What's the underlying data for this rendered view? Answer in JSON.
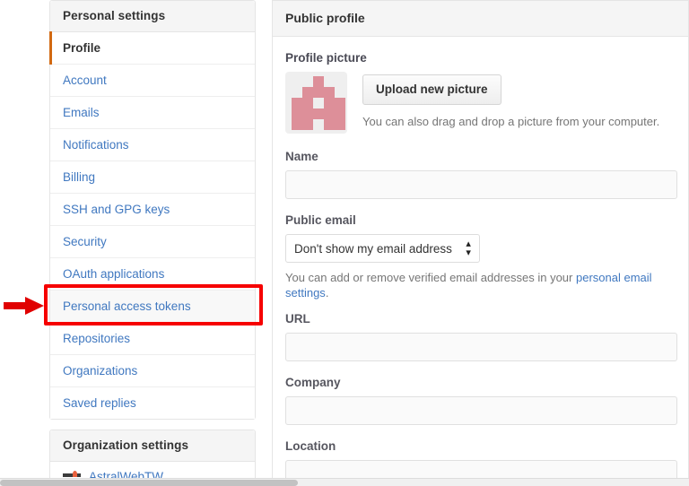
{
  "sidebar": {
    "personal": {
      "header": "Personal settings",
      "items": [
        {
          "label": "Profile",
          "state": "selected"
        },
        {
          "label": "Account",
          "state": "normal"
        },
        {
          "label": "Emails",
          "state": "normal"
        },
        {
          "label": "Notifications",
          "state": "normal"
        },
        {
          "label": "Billing",
          "state": "normal"
        },
        {
          "label": "SSH and GPG keys",
          "state": "normal"
        },
        {
          "label": "Security",
          "state": "normal"
        },
        {
          "label": "OAuth applications",
          "state": "normal"
        },
        {
          "label": "Personal access tokens",
          "state": "highlighted"
        },
        {
          "label": "Repositories",
          "state": "normal"
        },
        {
          "label": "Organizations",
          "state": "normal"
        },
        {
          "label": "Saved replies",
          "state": "normal"
        }
      ]
    },
    "organization": {
      "header": "Organization settings",
      "items": [
        {
          "label": "AstralWebTW",
          "logo": "astralweb-logo-icon"
        }
      ]
    }
  },
  "main": {
    "header": "Public profile",
    "profile_picture": {
      "label": "Profile picture",
      "upload_button": "Upload new picture",
      "hint": "You can also drag and drop a picture from your computer.",
      "avatar_color": "#dd8f99",
      "avatar_background": "#efefef",
      "avatar_grid": [
        [
          0,
          0,
          1,
          0,
          0
        ],
        [
          0,
          1,
          1,
          1,
          0
        ],
        [
          1,
          1,
          0,
          1,
          1
        ],
        [
          1,
          1,
          1,
          1,
          1
        ],
        [
          1,
          1,
          0,
          1,
          1
        ]
      ]
    },
    "fields": [
      {
        "label": "Name",
        "value": "",
        "placeholder": "",
        "type": "text"
      },
      {
        "label": "URL",
        "value": "",
        "placeholder": "",
        "type": "text"
      },
      {
        "label": "Company",
        "value": "",
        "placeholder": "",
        "type": "text"
      },
      {
        "label": "Location",
        "value": "",
        "placeholder": "",
        "type": "text"
      }
    ],
    "public_email": {
      "label": "Public email",
      "selected_option": "Don't show my email address",
      "options": [
        "Don't show my email address"
      ],
      "hint_prefix": "You can add or remove verified email addresses in your ",
      "hint_link": "personal email settings",
      "hint_suffix": "."
    }
  },
  "annotations": {
    "box_color": "#f60000",
    "arrow_color": "#e00000",
    "target_label": "Personal access tokens"
  },
  "colors": {
    "link": "#4078c0",
    "selected_accent": "#d26911",
    "card_border": "#e5e5e5",
    "card_header_bg": "#f5f5f5",
    "muted_text": "#767676"
  }
}
